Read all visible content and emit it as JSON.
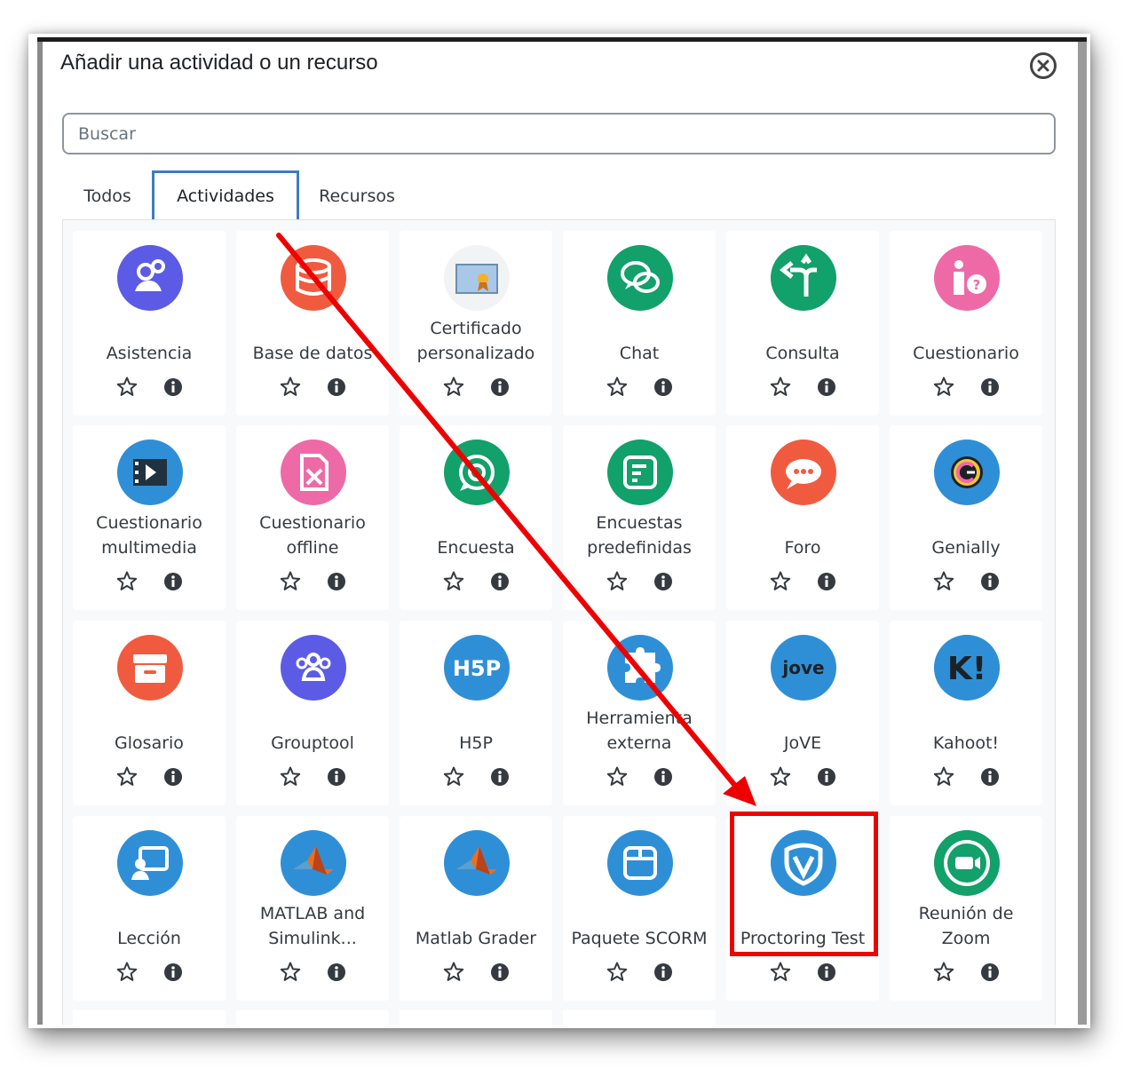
{
  "modal": {
    "title": "Añadir una actividad o un recurso"
  },
  "search": {
    "placeholder": "Buscar"
  },
  "tabs": [
    {
      "label": "Todos"
    },
    {
      "label": "Actividades"
    },
    {
      "label": "Recursos"
    }
  ],
  "activities": [
    {
      "label": "Asistencia",
      "icon": "attendance-icon",
      "color": "#5b5be6"
    },
    {
      "label": "Base de datos",
      "icon": "database-icon",
      "color": "#f05b40"
    },
    {
      "label": "Certificado\npersonalizado",
      "icon": "certificate-icon",
      "color": "#f1f3f5"
    },
    {
      "label": "Chat",
      "icon": "chat-icon",
      "color": "#12a06b"
    },
    {
      "label": "Consulta",
      "icon": "choice-icon",
      "color": "#12a06b"
    },
    {
      "label": "Cuestionario",
      "icon": "quiz-icon",
      "color": "#ee6aa7"
    },
    {
      "label": "Cuestionario\nmultimedia",
      "icon": "multimedia-quiz-icon",
      "color": "#2f8fd6"
    },
    {
      "label": "Cuestionario\noffline",
      "icon": "offline-quiz-icon",
      "color": "#ee6aa7"
    },
    {
      "label": "Encuesta",
      "icon": "feedback-icon",
      "color": "#12a06b"
    },
    {
      "label": "Encuestas\npredefinidas",
      "icon": "survey-icon",
      "color": "#12a06b"
    },
    {
      "label": "Foro",
      "icon": "forum-icon",
      "color": "#f05b40"
    },
    {
      "label": "Genially",
      "icon": "genially-icon",
      "color": "#2f8fd6"
    },
    {
      "label": "Glosario",
      "icon": "glossary-icon",
      "color": "#f05b40"
    },
    {
      "label": "Grouptool",
      "icon": "grouptool-icon",
      "color": "#5b5be6"
    },
    {
      "label": "H5P",
      "icon": "h5p-icon",
      "color": "#2f8fd6"
    },
    {
      "label": "Herramienta\nexterna",
      "icon": "external-tool-icon",
      "color": "#2f8fd6"
    },
    {
      "label": "JoVE",
      "icon": "jove-icon",
      "color": "#2f8fd6"
    },
    {
      "label": "Kahoot!",
      "icon": "kahoot-icon",
      "color": "#2f8fd6"
    },
    {
      "label": "Lección",
      "icon": "lesson-icon",
      "color": "#2f8fd6"
    },
    {
      "label": "MATLAB and\nSimulink...",
      "icon": "matlab-icon",
      "color": "#2f8fd6"
    },
    {
      "label": "Matlab Grader",
      "icon": "matlab-grader-icon",
      "color": "#2f8fd6"
    },
    {
      "label": "Paquete SCORM",
      "icon": "scorm-icon",
      "color": "#2f8fd6"
    },
    {
      "label": "Proctoring Test",
      "icon": "proctoring-icon",
      "color": "#2f8fd6"
    },
    {
      "label": "Reunión de\nZoom",
      "icon": "zoom-icon",
      "color": "#12a06b"
    }
  ],
  "colors": {
    "active_tab_border": "#3f7cc0",
    "annotation_red": "#ee0000"
  }
}
